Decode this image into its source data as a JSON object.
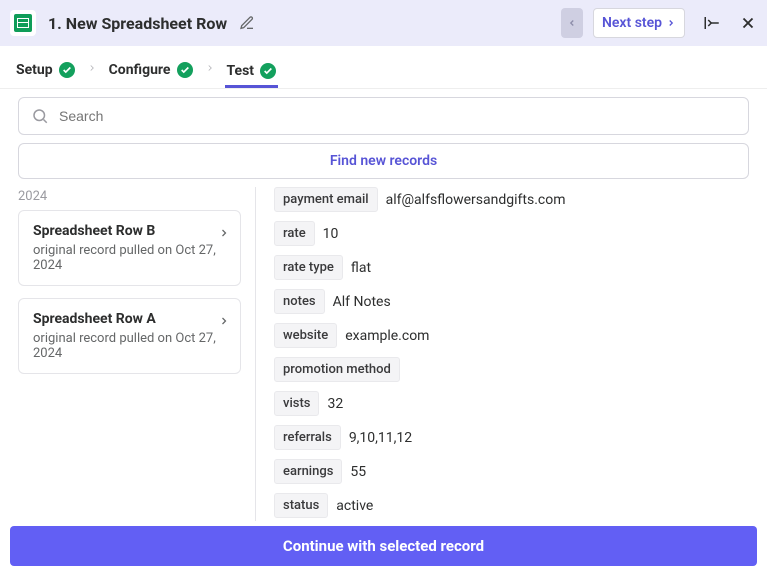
{
  "header": {
    "title": "1. New Spreadsheet Row",
    "next_step": "Next step"
  },
  "tabs": {
    "setup": "Setup",
    "configure": "Configure",
    "test": "Test"
  },
  "search": {
    "placeholder": "Search"
  },
  "find_records": "Find new records",
  "left": {
    "cut": "2024",
    "records": [
      {
        "title": "Spreadsheet Row B",
        "sub": "original record pulled on Oct 27, 2024"
      },
      {
        "title": "Spreadsheet Row A",
        "sub": "original record pulled on Oct 27, 2024"
      }
    ]
  },
  "fields": [
    {
      "key": "payment email",
      "value": "alf@alfsflowersandgifts.com"
    },
    {
      "key": "rate",
      "value": "10"
    },
    {
      "key": "rate type",
      "value": "flat"
    },
    {
      "key": "notes",
      "value": "Alf Notes"
    },
    {
      "key": "website",
      "value": "example.com"
    },
    {
      "key": "promotion method",
      "value": ""
    },
    {
      "key": "vists",
      "value": "32"
    },
    {
      "key": "referrals",
      "value": "9,10,11,12"
    },
    {
      "key": "earnings",
      "value": "55"
    },
    {
      "key": "status",
      "value": "active"
    }
  ],
  "footer": {
    "continue": "Continue with selected record"
  }
}
